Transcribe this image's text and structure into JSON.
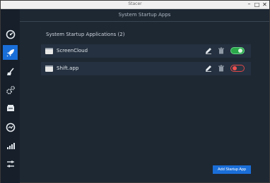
{
  "window": {
    "title": "Stacer"
  },
  "header": {
    "title": "System Startup Apps"
  },
  "section": {
    "title": "System Startup Applications (2)"
  },
  "sidebar": {
    "items": [
      {
        "icon": "dashboard-icon",
        "active": false
      },
      {
        "icon": "rocket-icon",
        "active": true
      },
      {
        "icon": "broom-icon",
        "active": false
      },
      {
        "icon": "gears-icon",
        "active": false
      },
      {
        "icon": "uninstaller-icon",
        "active": false
      },
      {
        "icon": "resources-icon",
        "active": false
      },
      {
        "icon": "chart-bars-icon",
        "active": false
      },
      {
        "icon": "sliders-icon",
        "active": false
      }
    ]
  },
  "apps": [
    {
      "name": "ScreenCloud",
      "enabled": true
    },
    {
      "name": "Shift.app",
      "enabled": false
    }
  ],
  "actions": {
    "add_label": "Add Startup App"
  },
  "colors": {
    "accent": "#1a6ed8",
    "enabled": "#2aa84a",
    "disabled": "#e04848",
    "background": "#1e2833"
  }
}
